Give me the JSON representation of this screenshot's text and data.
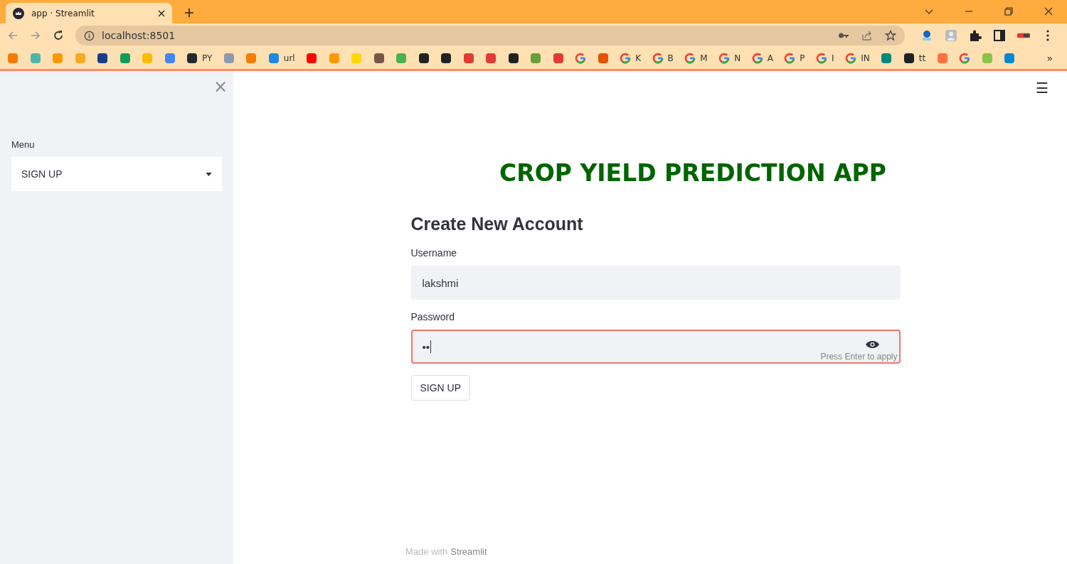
{
  "browser": {
    "tab": {
      "title": "app · Streamlit",
      "selected": true
    },
    "address": "localhost:8501",
    "bookmarks": [
      {
        "kind": "site",
        "color": "#f57c00"
      },
      {
        "kind": "site",
        "color": "#4db6ac"
      },
      {
        "kind": "site",
        "color": "#ff9800"
      },
      {
        "kind": "site",
        "color": "#f9a825"
      },
      {
        "kind": "site",
        "color": "#1a3c8c"
      },
      {
        "kind": "site",
        "color": "#0f9d58"
      },
      {
        "kind": "site",
        "color": "#fbbc04"
      },
      {
        "kind": "site",
        "color": "#4285f4"
      },
      {
        "kind": "site",
        "color": "#24292e",
        "label": "PY"
      },
      {
        "kind": "site",
        "color": "#8e9aaf"
      },
      {
        "kind": "site",
        "color": "#f57c00"
      },
      {
        "kind": "site",
        "color": "#1e88e5",
        "label": "url"
      },
      {
        "kind": "site",
        "color": "#ff0000"
      },
      {
        "kind": "site",
        "color": "#ff9800"
      },
      {
        "kind": "site",
        "color": "#ffd600"
      },
      {
        "kind": "site",
        "color": "#795548"
      },
      {
        "kind": "site",
        "color": "#4caf50"
      },
      {
        "kind": "site",
        "color": "#212121"
      },
      {
        "kind": "site",
        "color": "#212121"
      },
      {
        "kind": "site",
        "color": "#e53935"
      },
      {
        "kind": "site",
        "color": "#e53935"
      },
      {
        "kind": "site",
        "color": "#212121"
      },
      {
        "kind": "site",
        "color": "#689f38"
      },
      {
        "kind": "site",
        "color": "#e53935"
      },
      {
        "kind": "google"
      },
      {
        "kind": "site",
        "color": "#e65100"
      },
      {
        "kind": "google",
        "label": "K"
      },
      {
        "kind": "google",
        "label": "B"
      },
      {
        "kind": "google",
        "label": "M"
      },
      {
        "kind": "google",
        "label": "N"
      },
      {
        "kind": "google",
        "label": "A"
      },
      {
        "kind": "google",
        "label": "P"
      },
      {
        "kind": "google",
        "label": "I"
      },
      {
        "kind": "google",
        "label": "IN"
      },
      {
        "kind": "site",
        "color": "#00897b"
      },
      {
        "kind": "site",
        "color": "#212121",
        "label": "tt"
      },
      {
        "kind": "site",
        "color": "#ff7043"
      },
      {
        "kind": "google"
      },
      {
        "kind": "site",
        "color": "#8bc34a"
      },
      {
        "kind": "site",
        "color": "#0288d1"
      }
    ],
    "more": "»"
  },
  "sidebar": {
    "close": "×",
    "menu_label": "Menu",
    "menu_value": "SIGN UP"
  },
  "main": {
    "menu_icon": "☰",
    "title": "CROP YIELD PREDICTION APP",
    "subtitle": "Create New Account",
    "fields": [
      {
        "label": "Username",
        "value": "lakshmi",
        "focused": false
      },
      {
        "label": "Password",
        "value": "••",
        "focused": true,
        "hint": "Press Enter to apply"
      }
    ],
    "button": "SIGN UP",
    "footer_prefix": "Made with",
    "footer_brand": "Streamlit"
  }
}
